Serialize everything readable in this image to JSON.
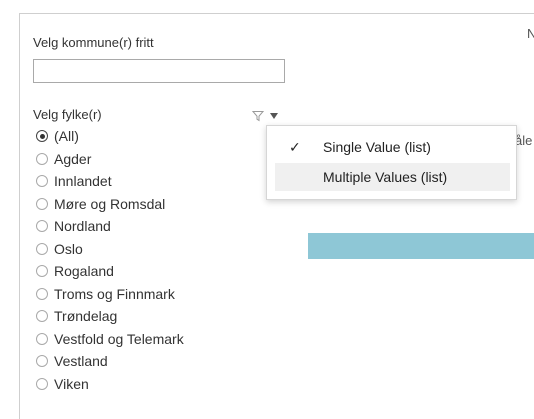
{
  "municipality": {
    "label": "Velg kommune(r) fritt",
    "value": "",
    "placeholder": ""
  },
  "county": {
    "label": "Velg fylke(r)",
    "selected": "(All)",
    "options": [
      "(All)",
      "Agder",
      "Innlandet",
      "Møre og Romsdal",
      "Nordland",
      "Oslo",
      "Rogaland",
      "Troms og Finnmark",
      "Trøndelag",
      "Vestfold og Telemark",
      "Vestland",
      "Viken"
    ]
  },
  "dropdown_menu": {
    "items": [
      {
        "label": "Single Value (list)",
        "checked": true,
        "check": "✓"
      },
      {
        "label": "Multiple Values (list)",
        "checked": false,
        "check": ""
      }
    ]
  },
  "background": {
    "edge_text_top": "N",
    "edge_text_mid": "åle"
  },
  "icons": {
    "filter": "filter-icon",
    "menu": "chevron-down-icon",
    "check": "checkmark-icon"
  },
  "colors": {
    "accent_bar": "#8ec7d6",
    "border": "#cfcfcf",
    "hover_row": "#f0f0f0"
  }
}
